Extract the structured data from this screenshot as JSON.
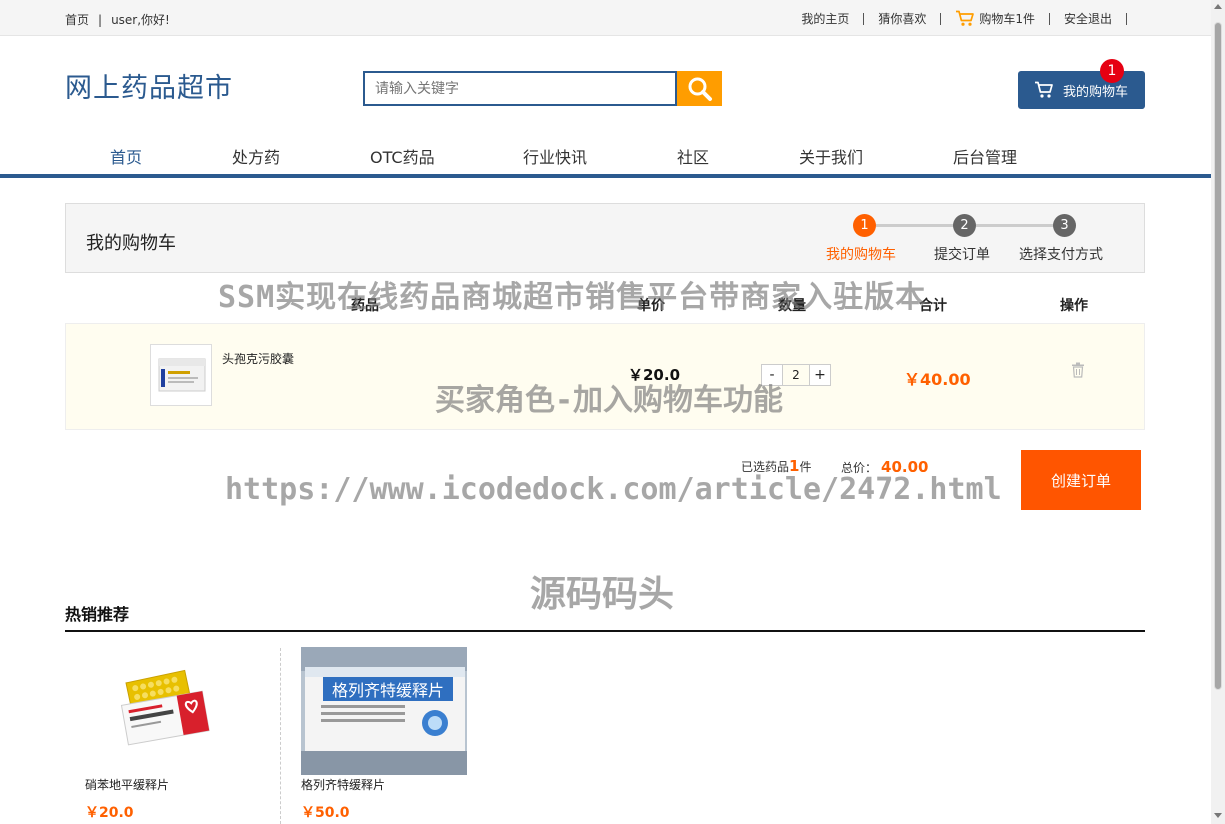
{
  "topbar": {
    "home": "首页",
    "sep": "|",
    "greeting": "user,你好!",
    "my_home": "我的主页",
    "guess": "猜你喜欢",
    "cart": "购物车1件",
    "logout": "安全退出"
  },
  "header": {
    "logo": "网上药品超市",
    "search_placeholder": "请输入关键字",
    "cart_button": "我的购物车",
    "cart_badge": "1"
  },
  "nav": {
    "items": [
      "首页",
      "处方药",
      "OTC药品",
      "行业快讯",
      "社区",
      "关于我们",
      "后台管理"
    ]
  },
  "cart_panel": {
    "title": "我的购物车",
    "steps": [
      {
        "num": "1",
        "label": "我的购物车"
      },
      {
        "num": "2",
        "label": "提交订单"
      },
      {
        "num": "3",
        "label": "选择支付方式"
      }
    ]
  },
  "table": {
    "headers": [
      "药品",
      "单价",
      "数量",
      "合计",
      "操作"
    ],
    "rows": [
      {
        "name": "头孢克污胶囊",
        "unit_price": "￥20.0",
        "qty": "2",
        "subtotal": "￥40.00"
      }
    ]
  },
  "summary": {
    "selected_prefix": "已选药品",
    "selected_count": "1",
    "selected_suffix": "件",
    "total_label": "总价：",
    "total_value": "40.00",
    "create_order": "创建订单"
  },
  "watermarks": {
    "line1": "SSM实现在线药品商城超市销售平台带商家入驻版本",
    "line2": "买家角色-加入购物车功能",
    "line3": "https://www.icodedock.com/article/2472.html",
    "line4": "源码码头"
  },
  "hot": {
    "title": "热销推荐",
    "items": [
      {
        "name": "硝苯地平缓释片",
        "price": "￥20.0"
      },
      {
        "name": "格列齐特缓释片",
        "price": "￥50.0"
      }
    ],
    "box2_text": "格列齐特缓释片"
  },
  "colors": {
    "brand": "#2b5a8f",
    "accent": "#ff6000",
    "search_button": "#ff9d00"
  }
}
